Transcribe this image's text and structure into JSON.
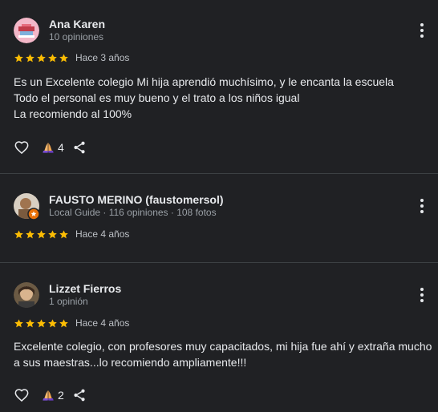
{
  "colors": {
    "background": "#202124",
    "star": "#fbbc04",
    "text": "#e8eaed",
    "muted": "#9aa0a6",
    "divider": "#3c4043"
  },
  "reviews": [
    {
      "name": "Ana Karen",
      "meta": "10 opiniones",
      "stars": 5,
      "date": "Hace 3 años",
      "text_lines": [
        "Es un Excelente colegio Mi hija aprendió muchísimo, y le encanta la escuela",
        "Todo el personal es muy bueno y el trato a los niños igual",
        "La recomiendo al 100%"
      ],
      "reaction_count": "4",
      "icons": {
        "like": "heart-outline-icon",
        "reaction": "praying-hands-icon",
        "share": "share-icon",
        "more": "more-vertical-icon"
      }
    },
    {
      "name": "FAUSTO MERINO (faustomersol)",
      "meta": "Local Guide · 116 opiniones · 108 fotos",
      "stars": 5,
      "date": "Hace 4 años",
      "icons": {
        "more": "more-vertical-icon",
        "badge": "local-guide-badge-icon"
      }
    },
    {
      "name": "Lizzet Fierros",
      "meta": "1 opinión",
      "stars": 5,
      "date": "Hace 4 años",
      "text_lines": [
        "Excelente colegio, con profesores muy capacitados, mi hija fue ahí y extraña mucho",
        "a sus maestras...lo recomiendo ampliamente!!!"
      ],
      "reaction_count": "2",
      "icons": {
        "like": "heart-outline-icon",
        "reaction": "praying-hands-icon",
        "share": "share-icon",
        "more": "more-vertical-icon"
      }
    }
  ]
}
